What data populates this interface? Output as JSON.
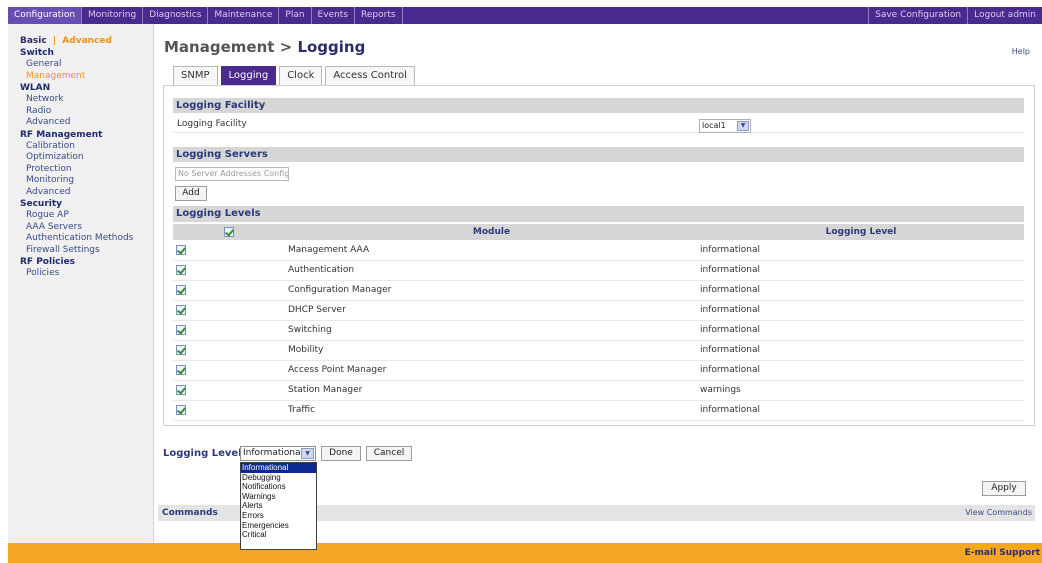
{
  "top_nav": {
    "tabs": [
      "Configuration",
      "Monitoring",
      "Diagnostics",
      "Maintenance",
      "Plan",
      "Events",
      "Reports"
    ],
    "save": "Save Configuration",
    "logout": "Logout admin"
  },
  "sidebar": {
    "basic": "Basic",
    "sep": "|",
    "advanced": "Advanced",
    "switch": {
      "title": "Switch",
      "items": [
        "General",
        "Management"
      ]
    },
    "wlan": {
      "title": "WLAN",
      "items": [
        "Network",
        "Radio",
        "Advanced"
      ]
    },
    "rf": {
      "title": "RF Management",
      "items": [
        "Calibration",
        "Optimization",
        "Protection",
        "Monitoring",
        "Advanced"
      ]
    },
    "security": {
      "title": "Security",
      "items": [
        "Rogue AP",
        "AAA Servers",
        "Authentication Methods",
        "Firewall Settings"
      ]
    },
    "rf_policies": {
      "title": "RF Policies",
      "items": [
        "Policies"
      ]
    }
  },
  "page": {
    "title_prefix": "Management > ",
    "title": "Logging",
    "help": "Help",
    "tabs": [
      "SNMP",
      "Logging",
      "Clock",
      "Access Control"
    ]
  },
  "facility": {
    "header": "Logging Facility",
    "label": "Logging Facility",
    "value": "local1"
  },
  "servers": {
    "header": "Logging Servers",
    "placeholder": "No Server Addresses Configured",
    "add": "Add"
  },
  "levels": {
    "header": "Logging Levels",
    "columns": {
      "module": "Module",
      "level": "Logging Level"
    },
    "rows": [
      {
        "module": "Management AAA",
        "level": "informational"
      },
      {
        "module": "Authentication",
        "level": "informational"
      },
      {
        "module": "Configuration Manager",
        "level": "informational"
      },
      {
        "module": "DHCP Server",
        "level": "informational"
      },
      {
        "module": "Switching",
        "level": "informational"
      },
      {
        "module": "Mobility",
        "level": "informational"
      },
      {
        "module": "Access Point Manager",
        "level": "informational"
      },
      {
        "module": "Station Manager",
        "level": "warnings"
      },
      {
        "module": "Traffic",
        "level": "informational"
      }
    ]
  },
  "level_editor": {
    "label": "Logging Level",
    "selected": "Informational",
    "done": "Done",
    "cancel": "Cancel",
    "options": [
      "Informational",
      "Debugging",
      "Notifications",
      "Warnings",
      "Alerts",
      "Errors",
      "Emergencies",
      "Critical"
    ]
  },
  "apply": "Apply",
  "commands": {
    "label": "Commands",
    "view": "View Commands"
  },
  "footer": {
    "email": "E-mail Support"
  }
}
